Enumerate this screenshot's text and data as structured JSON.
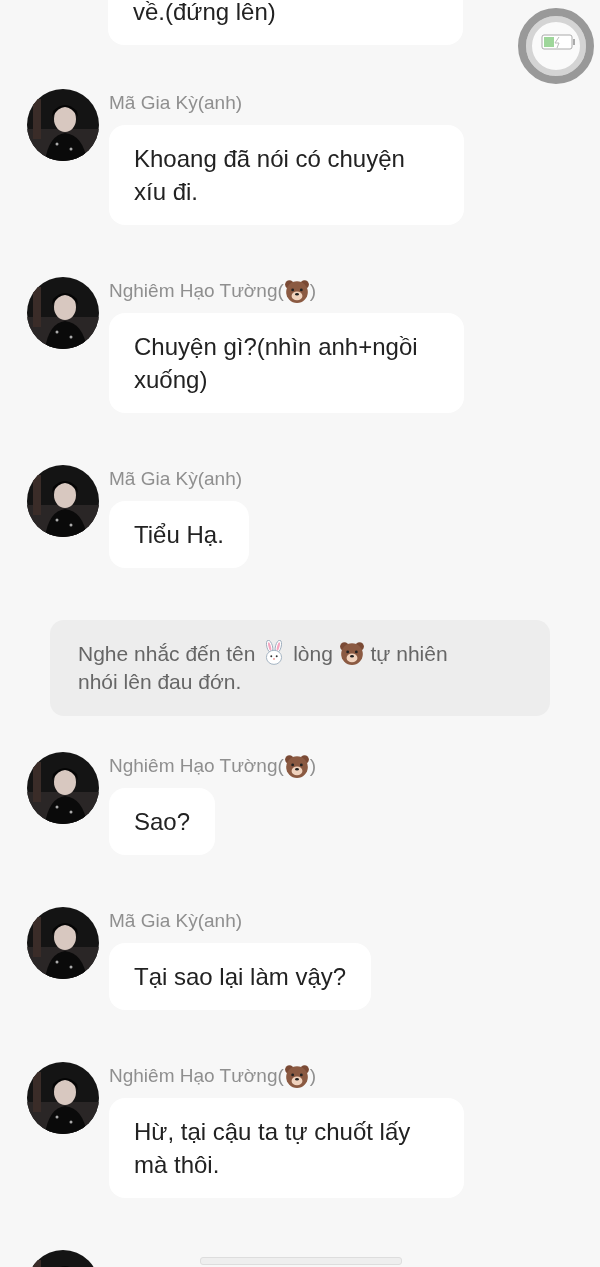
{
  "messages": [
    {
      "kind": "bubble_cut",
      "text": "về.(đứng lên)"
    },
    {
      "kind": "message",
      "sender": [
        {
          "kind": "text",
          "text": "Mã Gia Kỳ(anh)"
        }
      ],
      "text": "Khoang đã nói có chuyện xíu đi."
    },
    {
      "kind": "message",
      "sender": [
        {
          "kind": "text",
          "text": "Nghiêm Hạo Tường("
        },
        {
          "kind": "bear"
        },
        {
          "kind": "text",
          "text": ")"
        }
      ],
      "text": "Chuyện gì?(nhìn anh+ngồi xuống)"
    },
    {
      "kind": "message",
      "sender": [
        {
          "kind": "text",
          "text": "Mã Gia Kỳ(anh)"
        }
      ],
      "text": "Tiểu Hạ."
    },
    {
      "kind": "narration",
      "parts": [
        {
          "kind": "text",
          "text": "Nghe nhắc đến tên "
        },
        {
          "kind": "rabbit"
        },
        {
          "kind": "text",
          "text": " lòng "
        },
        {
          "kind": "bear"
        },
        {
          "kind": "text",
          "text": " tự nhiên nhói lên đau đớn."
        }
      ]
    },
    {
      "kind": "message",
      "sender": [
        {
          "kind": "text",
          "text": "Nghiêm Hạo Tường("
        },
        {
          "kind": "bear"
        },
        {
          "kind": "text",
          "text": ")"
        }
      ],
      "text": "Sao?"
    },
    {
      "kind": "message",
      "sender": [
        {
          "kind": "text",
          "text": "Mã Gia Kỳ(anh)"
        }
      ],
      "text": "Tại sao lại làm vậy?"
    },
    {
      "kind": "message",
      "sender": [
        {
          "kind": "text",
          "text": "Nghiêm Hạo Tường("
        },
        {
          "kind": "bear"
        },
        {
          "kind": "text",
          "text": ")"
        }
      ],
      "text": "Hừ, tại cậu ta tự chuốt lấy mà thôi."
    },
    {
      "kind": "avatar_cut"
    }
  ]
}
